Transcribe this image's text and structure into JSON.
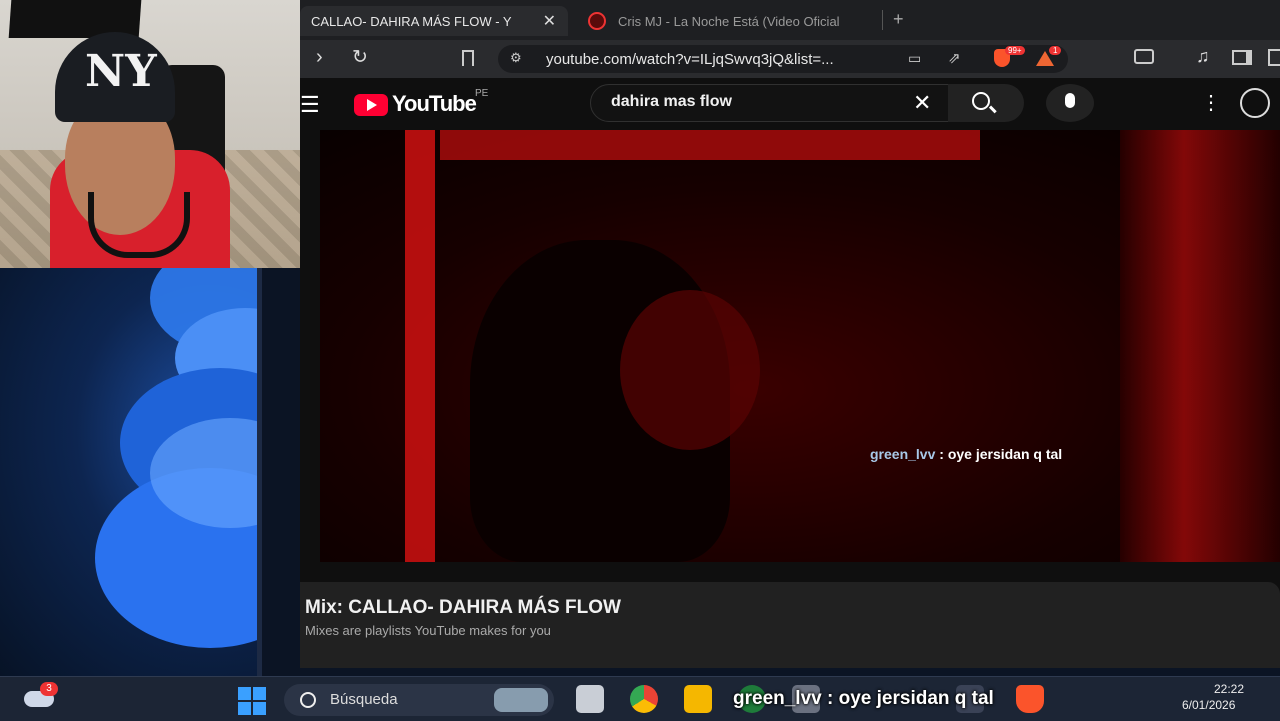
{
  "browser": {
    "tabs": [
      {
        "title": "CALLAO- DAHIRA MÁS FLOW - Y",
        "active": true
      },
      {
        "title": "Cris MJ - La Noche Está (Video Oficial",
        "active": false
      }
    ],
    "url": "youtube.com/watch?v=ILjqSwvq3jQ&list=...",
    "badges": {
      "brave_count": "99+",
      "alert_count": "1"
    }
  },
  "youtube": {
    "logo_text": "YouTube",
    "region": "PE",
    "search_query": "dahira mas flow"
  },
  "video": {
    "overlay_user": "green_lvv",
    "overlay_message": ": oye jersidan q tal"
  },
  "mix": {
    "title": "Mix: CALLAO- DAHIRA MÁS FLOW",
    "subtitle": "Mixes are playlists YouTube makes for you"
  },
  "taskbar": {
    "weather_badge": "3",
    "search_label": "Búsqueda",
    "chat_user": "green_lvv",
    "chat_message": ": oye jersidan q tal",
    "time": "22:22",
    "date": "6/01/2026"
  },
  "colors": {
    "youtube_red": "#ff0033",
    "chat_user": "#a8c8e8",
    "taskbar_bg": "#1c2535"
  }
}
